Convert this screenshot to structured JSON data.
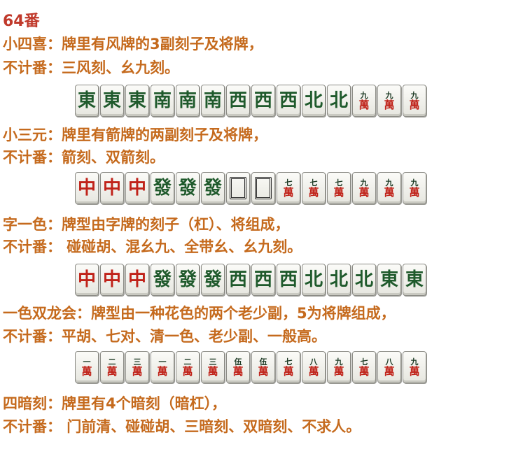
{
  "title": "64番",
  "sections": [
    {
      "line1": "小四喜：牌里有风牌的3副刻子及将牌，",
      "line2": "不计番：三风刻、幺九刻。",
      "tiles": [
        {
          "big": "東",
          "color": "green"
        },
        {
          "big": "東",
          "color": "green"
        },
        {
          "big": "東",
          "color": "green"
        },
        {
          "big": "南",
          "color": "green"
        },
        {
          "big": "南",
          "color": "green"
        },
        {
          "big": "南",
          "color": "green"
        },
        {
          "big": "西",
          "color": "green"
        },
        {
          "big": "西",
          "color": "green"
        },
        {
          "big": "西",
          "color": "green"
        },
        {
          "big": "北",
          "color": "green"
        },
        {
          "big": "北",
          "color": "green"
        },
        {
          "top": "九",
          "bottom": "萬"
        },
        {
          "top": "九",
          "bottom": "萬"
        },
        {
          "top": "九",
          "bottom": "萬"
        }
      ]
    },
    {
      "line1": "小三元：牌里有箭牌的两副刻子及将牌，",
      "line2": "不计番：箭刻、双箭刻。",
      "tiles": [
        {
          "big": "中",
          "color": "red"
        },
        {
          "big": "中",
          "color": "red"
        },
        {
          "big": "中",
          "color": "red"
        },
        {
          "big": "發",
          "color": "green"
        },
        {
          "big": "發",
          "color": "green"
        },
        {
          "big": "發",
          "color": "green"
        },
        {
          "blank": true
        },
        {
          "blank": true
        },
        {
          "top": "七",
          "bottom": "萬"
        },
        {
          "top": "七",
          "bottom": "萬"
        },
        {
          "top": "七",
          "bottom": "萬"
        },
        {
          "top": "九",
          "bottom": "萬"
        },
        {
          "top": "九",
          "bottom": "萬"
        },
        {
          "top": "九",
          "bottom": "萬"
        }
      ]
    },
    {
      "line1": "字一色：牌型由字牌的刻子（杠）、将组成，",
      "line2": "不计番： 碰碰胡、混幺九、全带幺、幺九刻。",
      "tiles": [
        {
          "big": "中",
          "color": "red"
        },
        {
          "big": "中",
          "color": "red"
        },
        {
          "big": "中",
          "color": "red"
        },
        {
          "big": "發",
          "color": "green"
        },
        {
          "big": "發",
          "color": "green"
        },
        {
          "big": "發",
          "color": "green"
        },
        {
          "big": "西",
          "color": "green"
        },
        {
          "big": "西",
          "color": "green"
        },
        {
          "big": "西",
          "color": "green"
        },
        {
          "big": "北",
          "color": "green"
        },
        {
          "big": "北",
          "color": "green"
        },
        {
          "big": "北",
          "color": "green"
        },
        {
          "big": "東",
          "color": "green"
        },
        {
          "big": "東",
          "color": "green"
        }
      ]
    },
    {
      "line1": "一色双龙会：牌型由一种花色的两个老少副，5为将牌组成，",
      "line2": "不计番：平胡、七对、清一色、老少副、一般高。",
      "tiles": [
        {
          "top": "一",
          "bottom": "萬"
        },
        {
          "top": "二",
          "bottom": "萬"
        },
        {
          "top": "三",
          "bottom": "萬"
        },
        {
          "top": "一",
          "bottom": "萬"
        },
        {
          "top": "二",
          "bottom": "萬"
        },
        {
          "top": "三",
          "bottom": "萬"
        },
        {
          "top": "伍",
          "bottom": "萬"
        },
        {
          "top": "伍",
          "bottom": "萬"
        },
        {
          "top": "七",
          "bottom": "萬"
        },
        {
          "top": "八",
          "bottom": "萬"
        },
        {
          "top": "九",
          "bottom": "萬"
        },
        {
          "top": "七",
          "bottom": "萬"
        },
        {
          "top": "八",
          "bottom": "萬"
        },
        {
          "top": "九",
          "bottom": "萬"
        }
      ]
    },
    {
      "line1": "四暗刻：牌里有4个暗刻（暗杠），",
      "line2": "不计番： 门前清、碰碰胡、三暗刻、双暗刻、不求人。"
    }
  ]
}
